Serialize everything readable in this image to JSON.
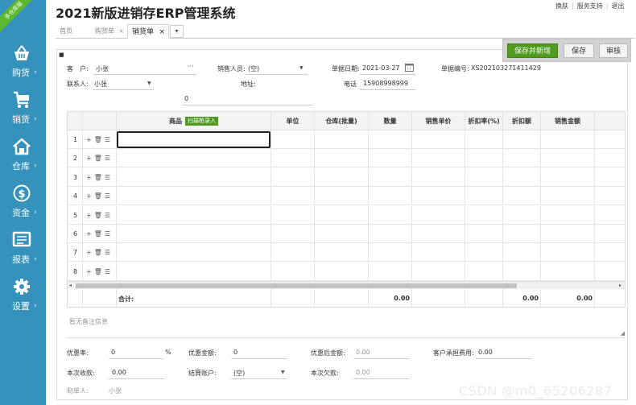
{
  "ribbon": "多仓库版",
  "app_title": "2021新版进销存ERP管理系统",
  "top_links": [
    "换肤",
    "服务支持",
    "退出"
  ],
  "nav": [
    {
      "label": "购货",
      "icon": "basket-icon"
    },
    {
      "label": "销货",
      "icon": "cart-icon"
    },
    {
      "label": "仓库",
      "icon": "house-icon"
    },
    {
      "label": "资金",
      "icon": "dollar-icon"
    },
    {
      "label": "报表",
      "icon": "report-icon"
    },
    {
      "label": "设置",
      "icon": "gear-icon"
    }
  ],
  "tabs": [
    {
      "label": "首页",
      "closable": false,
      "active": false
    },
    {
      "label": "购货单",
      "closable": true,
      "active": false
    },
    {
      "label": "销货单",
      "closable": true,
      "active": true
    }
  ],
  "buttons": {
    "save_new": "保存并新增",
    "save": "保存",
    "audit": "审核"
  },
  "form": {
    "customer_label": "客　户:",
    "customer_value": "小张",
    "more_glyph": "···",
    "salesperson_label": "销售人员:",
    "salesperson_value": "(空)",
    "date_label": "单据日期:",
    "date_value": "2021-03-27",
    "docno_label": "单据编号:",
    "docno_value": "XS202103271411429",
    "contact_label": "联系人:",
    "contact_value": "小张",
    "address_label": "地址:",
    "address_value": "0",
    "phone_label": "电话",
    "phone_value": "15908998999"
  },
  "grid": {
    "headers": [
      "商品",
      "单位",
      "仓库(批量)",
      "数量",
      "销售单价",
      "折扣率(%)",
      "折扣额",
      "销售金额"
    ],
    "scan_button": "扫描枪录入",
    "row_numbers": [
      "1",
      "2",
      "3",
      "4",
      "5",
      "6",
      "7",
      "8"
    ],
    "row_ops": [
      "+",
      "🗑",
      "☰"
    ],
    "footer_label": "合计:",
    "footer_quantity": "0.00",
    "footer_discount": "0.00",
    "footer_amount": "0.00"
  },
  "remark_placeholder": "暂无备注信息",
  "bottom": {
    "discount_rate_label": "优惠率:",
    "discount_rate_value": "0",
    "percent": "%",
    "discount_amount_label": "优惠金额:",
    "discount_amount_value": "0",
    "after_discount_label": "优惠后金额:",
    "after_discount_value": "0.00",
    "customer_fee_label": "客户承担费用:",
    "customer_fee_value": "0.00",
    "received_label": "本次收款:",
    "received_value": "0.00",
    "account_label": "结算账户:",
    "account_value": "(空)",
    "owed_label": "本次欠款:",
    "owed_value": "0.00",
    "maker_label": "制单人:",
    "maker_value": "小张"
  },
  "watermark": "CSDN @m0_65206287",
  "colors": {
    "sidebar": "#3592bd",
    "primary_button": "#4f9a1f",
    "ribbon": "#5cb82e"
  }
}
